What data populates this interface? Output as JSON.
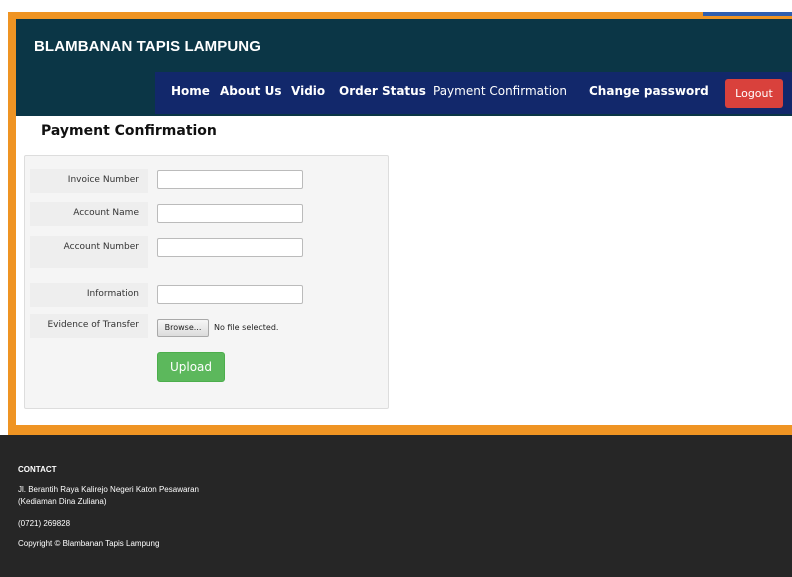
{
  "header": {
    "brand": "BLAMBANAN TAPIS LAMPUNG",
    "nav": [
      "Home",
      "About Us",
      "Vidio",
      "Order Status",
      "Payment Confirmation",
      "Change password"
    ],
    "logout_label": "Logout"
  },
  "page": {
    "title": "Payment Confirmation"
  },
  "form": {
    "invoice_label": "Invoice Number",
    "account_name_label": "Account Name",
    "account_number_label": "Account Number",
    "information_label": "Information",
    "evidence_label": "Evidence of Transfer",
    "browse_label": "Browse...",
    "file_status": "No file selected.",
    "upload_label": "Upload"
  },
  "footer": {
    "heading": "CONTACT",
    "address_line1": "Jl. Berantih Raya Kalirejo Negeri Katon Pesawaran",
    "address_line2": "(Kediaman Dina Zuliana)",
    "phone": "(0721) 269828",
    "copyright": "Copyright © Blambanan Tapis Lampung"
  },
  "colors": {
    "frame_orange": "#ef9423",
    "header_bg": "#0b3646",
    "nav_bg": "#12286b",
    "logout_red": "#d9413c",
    "upload_green": "#5cb85c",
    "footer_bg": "#262626"
  }
}
